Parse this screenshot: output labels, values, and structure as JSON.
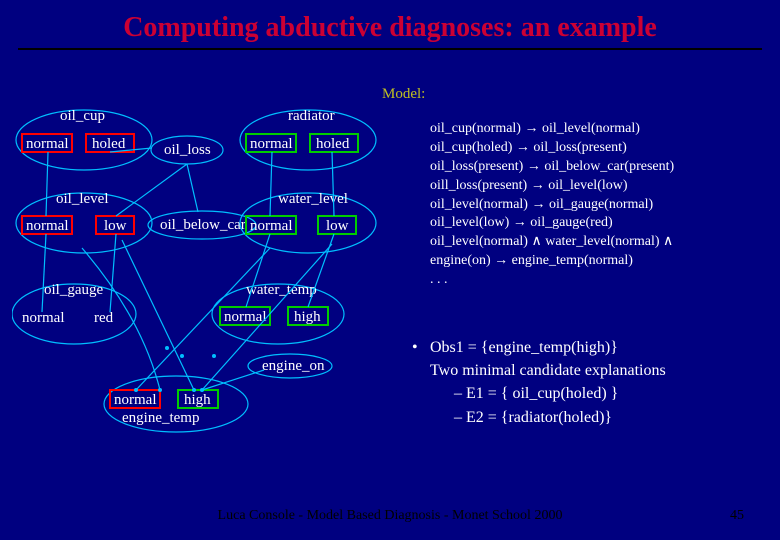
{
  "title": "Computing abductive diagnoses: an example",
  "footer": {
    "center": "Luca Console - Model Based Diagnosis - Monet School 2000",
    "right": "45"
  },
  "model_label": "Model:",
  "nodes": {
    "oil_cup": {
      "title": "oil_cup",
      "v1": "normal",
      "v2": "holed"
    },
    "oil_loss": {
      "title": "oil_loss"
    },
    "radiator": {
      "title": "radiator",
      "v1": "normal",
      "v2": "holed"
    },
    "oil_level": {
      "title": "oil_level",
      "v1": "normal",
      "v2": "low"
    },
    "oil_below_car": {
      "title": "oil_below_car"
    },
    "water_level": {
      "title": "water_level",
      "v1": "normal",
      "v2": "low"
    },
    "oil_gauge": {
      "title": "oil_gauge",
      "v1": "normal",
      "v2": "red"
    },
    "water_temp": {
      "title": "water_temp",
      "v1": "normal",
      "v2": "high"
    },
    "engine_on": {
      "title": "engine_on"
    },
    "engine_temp": {
      "title": "engine_temp",
      "v1": "normal",
      "v2": "high"
    }
  },
  "rules": [
    "oil_cup(normal) → oil_level(normal)",
    "oil_cup(holed) → oil_loss(present)",
    "oil_loss(present) → oil_below_car(present)",
    "oill_loss(present) → oil_level(low)",
    "oil_level(normal) → oil_gauge(normal)",
    "oil_level(low) → oil_gauge(red)",
    "oil_level(normal) ∧ water_level(normal) ∧",
    "           engine(on) → engine_temp(normal)",
    ". . ."
  ],
  "obs": {
    "line1": "Obs1 = {engine_temp(high)}",
    "line2": "Two minimal candidate explanations",
    "e1_label": "– E1 = { oil_cup(holed) }",
    "e2_label": "– E2 = {radiator(holed)}"
  }
}
